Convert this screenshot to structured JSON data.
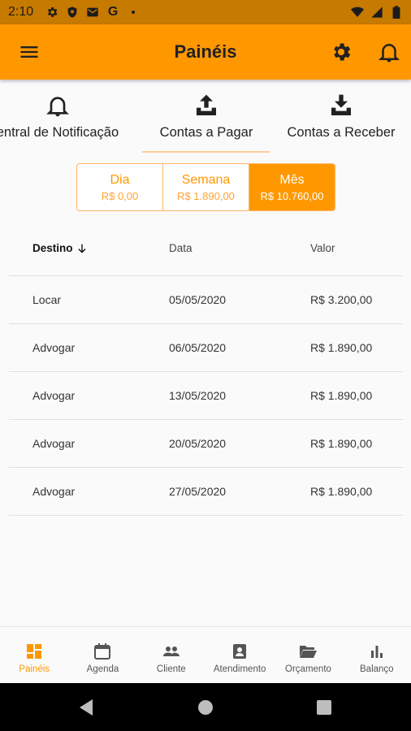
{
  "status_bar": {
    "time": "2:10",
    "google_letter": "G",
    "icons": [
      "gear-icon",
      "shield-icon",
      "mail-icon",
      "google-icon",
      "dot-icon",
      "wifi-icon",
      "signal-icon",
      "battery-icon"
    ]
  },
  "app_bar": {
    "title": "Painéis",
    "background": "#ff9800",
    "icons": [
      "menu-icon",
      "gear-icon",
      "bell-icon"
    ]
  },
  "tabs": [
    {
      "label": "Central de Notificação",
      "icon": "bell-icon"
    },
    {
      "label": "Contas a Pagar",
      "icon": "upload-icon",
      "selected": true
    },
    {
      "label": "Contas a Receber",
      "icon": "download-icon"
    }
  ],
  "period": [
    {
      "label": "Dia",
      "value": "R$ 0,00"
    },
    {
      "label": "Semana",
      "value": "R$ 1.890,00"
    },
    {
      "label": "Mês",
      "value": "R$ 10.760,00",
      "selected": true
    }
  ],
  "table": {
    "headers": {
      "destino": "Destino",
      "data": "Data",
      "valor": "Valor"
    },
    "rows": [
      {
        "destino": "Locar",
        "data": "05/05/2020",
        "valor": "R$ 3.200,00"
      },
      {
        "destino": "Advogar",
        "data": "06/05/2020",
        "valor": "R$ 1.890,00"
      },
      {
        "destino": "Advogar",
        "data": "13/05/2020",
        "valor": "R$ 1.890,00"
      },
      {
        "destino": "Advogar",
        "data": "20/05/2020",
        "valor": "R$ 1.890,00"
      },
      {
        "destino": "Advogar",
        "data": "27/05/2020",
        "valor": "R$ 1.890,00"
      }
    ]
  },
  "bottom_nav": [
    {
      "label": "Painéis",
      "icon": "dashboard-icon",
      "active": true
    },
    {
      "label": "Agenda",
      "icon": "calendar-icon"
    },
    {
      "label": "Cliente",
      "icon": "people-icon"
    },
    {
      "label": "Atendimento",
      "icon": "contact-card-icon"
    },
    {
      "label": "Orçamento",
      "icon": "folder-open-icon"
    },
    {
      "label": "Balanço",
      "icon": "bar-chart-icon"
    }
  ],
  "colors": {
    "accent": "#ff9800",
    "status_bar": "#c77a00",
    "accent_light": "#ffb566"
  }
}
